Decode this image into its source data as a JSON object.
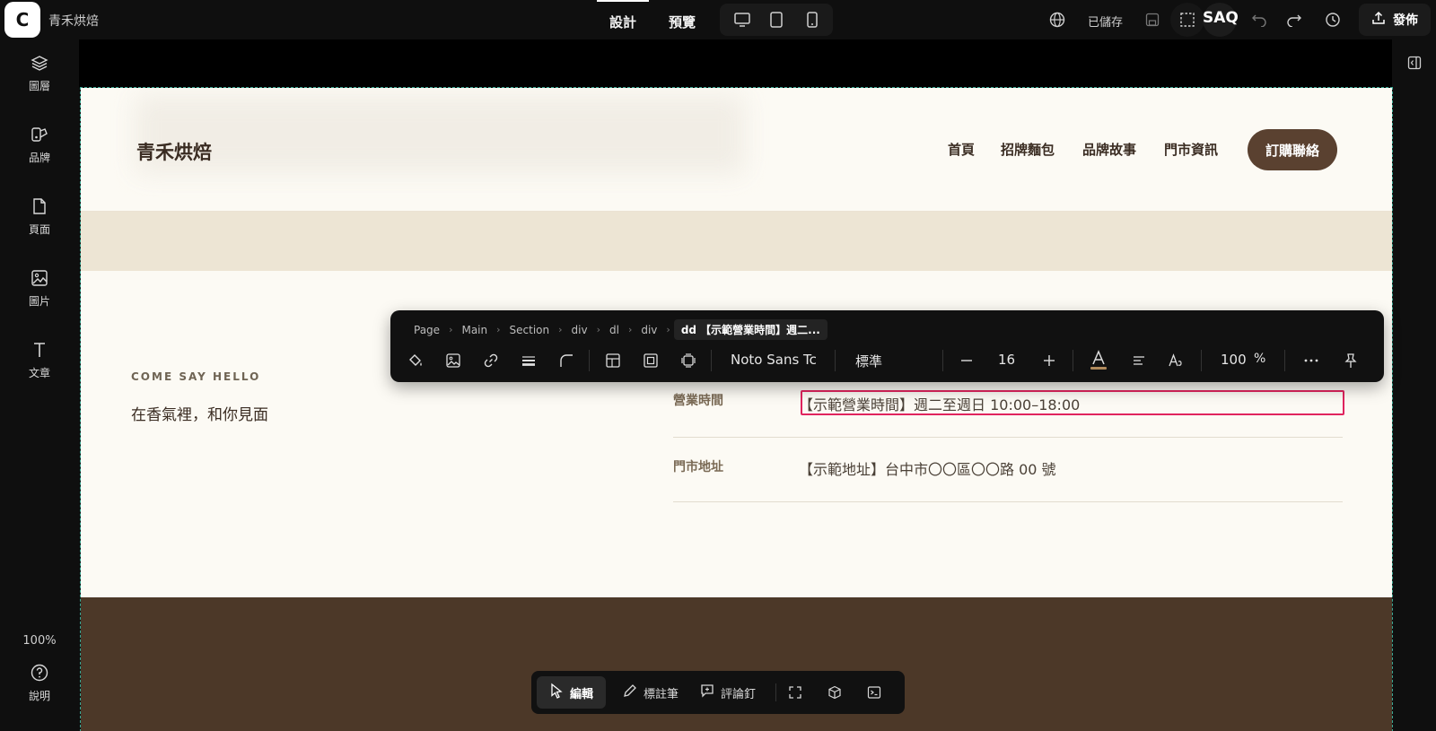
{
  "app": {
    "logo_letter": "C",
    "project_name": "青禾烘焙"
  },
  "topbar": {
    "tabs": [
      {
        "label": "設計",
        "active": true
      },
      {
        "label": "預覽",
        "active": false
      }
    ],
    "devices": [
      "desktop-icon",
      "tablet-icon",
      "mobile-icon"
    ],
    "saved_label": "已儲存",
    "user_initials": "SAQ",
    "publish_label": "發佈"
  },
  "sidebar": {
    "items": [
      {
        "icon": "layers-icon",
        "label": "圖層"
      },
      {
        "icon": "brand-icon",
        "label": "品牌"
      },
      {
        "icon": "page-icon",
        "label": "頁面"
      },
      {
        "icon": "image-icon",
        "label": "圖片"
      },
      {
        "icon": "text-icon",
        "label": "文章"
      }
    ],
    "zoom": "100%",
    "help_label": "說明"
  },
  "site": {
    "logo": "青禾烘焙",
    "nav": [
      "首頁",
      "招牌麵包",
      "品牌故事",
      "門市資訊"
    ],
    "cta": "訂購聯絡",
    "eyebrow": "COME SAY HELLO",
    "subhead": "在香氣裡，和你見面",
    "details": [
      {
        "term": "營業時間",
        "value": "【示範營業時間】週二至週日 10:00–18:00"
      },
      {
        "term": "門市地址",
        "value": "【示範地址】台中市〇〇區〇〇路 00 號"
      }
    ]
  },
  "toolbar": {
    "breadcrumbs": [
      "Page",
      "Main",
      "Section",
      "div",
      "dl",
      "div"
    ],
    "current_crumb": "dd 【示範營業時間】週二...",
    "font_family": "Noto Sans Tc",
    "font_weight": "標準",
    "font_size": "16",
    "opacity_value": "100",
    "opacity_unit": "%"
  },
  "bottom_bar": {
    "edit_label": "編輯",
    "annotate_label": "標註筆",
    "comment_label": "評論釘"
  },
  "colors": {
    "accent_selection": "#e0245e",
    "cta_brown": "#5a4130",
    "footer_brown": "#4c3828",
    "cream": "#fcfaf4",
    "beige": "#ede5d4"
  }
}
